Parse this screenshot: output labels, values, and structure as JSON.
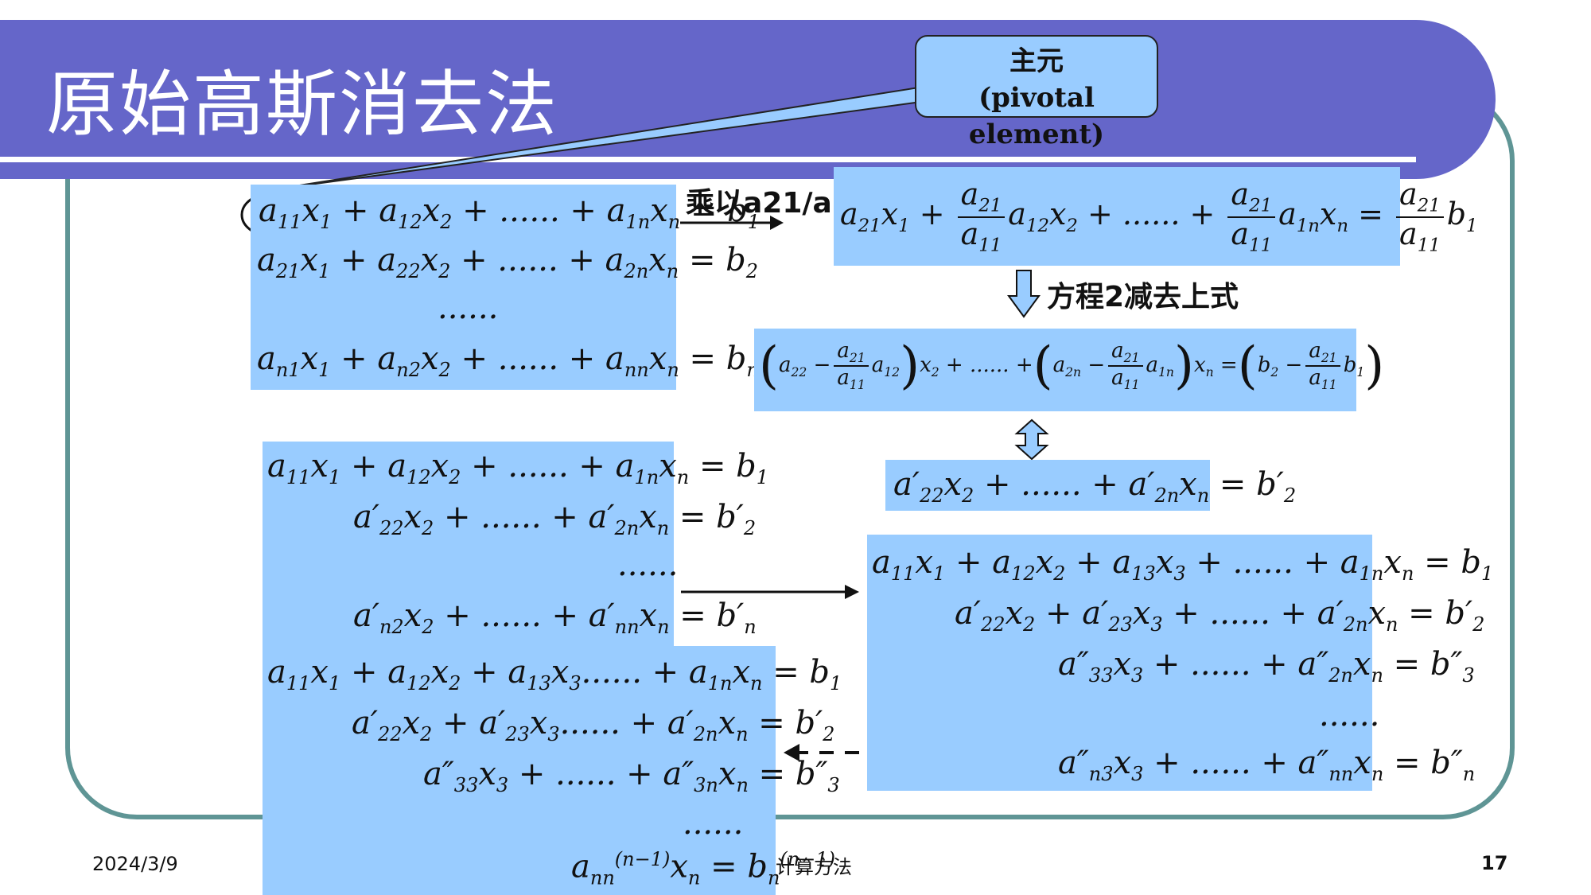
{
  "slide": {
    "title": "原始高斯消去法",
    "callout_line1": "主元",
    "callout_line2": "(pivotal element)",
    "step1_label": "乘以a21/a11",
    "step2_label": "方程2减去上式",
    "date": "2024/3/9",
    "footer_center": "计算方法",
    "page_number": "17"
  },
  "colors": {
    "title_bar": "#6566c9",
    "box": "#99ccff",
    "frame": "#5f9595"
  }
}
